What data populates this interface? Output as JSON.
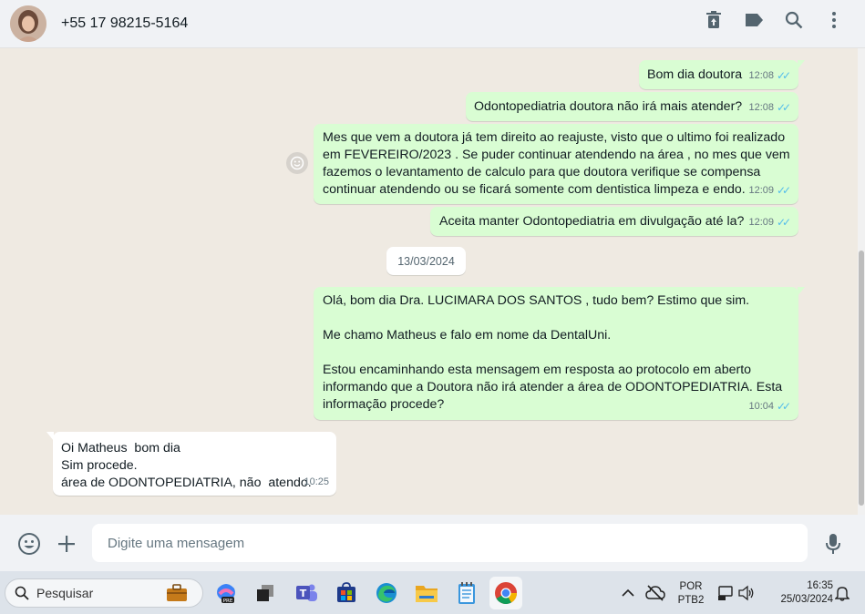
{
  "header": {
    "contact_name": "+55 17 98215-5164",
    "actions": [
      "trash-icon",
      "label-icon",
      "search-icon",
      "more-icon"
    ]
  },
  "messages": [
    {
      "direction": "out",
      "text": "Bom dia doutora",
      "time": "12:08",
      "ticks": "✓✓"
    },
    {
      "direction": "out",
      "text": "Odontopediatria doutora não irá mais atender?",
      "time": "12:08",
      "ticks": "✓✓"
    },
    {
      "direction": "out",
      "text": "Mes que vem a doutora já tem direito ao reajuste, visto que o ultimo foi realizado\nem FEVEREIRO/2023 . Se puder continuar atendendo na área , no mes que vem\nfazemos o levantamento de calculo para que doutora verifique se compensa\ncontinuar atendendo ou se ficará somente com dentistica limpeza e endo.",
      "time": "12:09",
      "ticks": "✓✓"
    },
    {
      "direction": "out",
      "text": "Aceita manter Odontopediatria em divulgação até la?",
      "time": "12:09",
      "ticks": "✓✓"
    },
    {
      "direction": "out",
      "text": "Olá, bom dia Dra. LUCIMARA DOS SANTOS , tudo bem? Estimo que sim.\n\nMe chamo Matheus e falo em nome da DentalUni.\n\nEstou encaminhando esta mensagem em resposta ao protocolo em aberto\ninformando que a Doutora não irá atender a área de ODONTOPEDIATRIA. Esta\ninformação procede?",
      "time": "10:04",
      "ticks": "✓✓"
    },
    {
      "direction": "in",
      "text": "Oi Matheus  bom dia\nSim procede.\nárea de ODONTOPEDIATRIA, não  atendo.",
      "time": "10:25"
    }
  ],
  "date_separator": "13/03/2024",
  "composer": {
    "placeholder": "Digite uma mensagem"
  },
  "taskbar": {
    "search_label": "Pesquisar",
    "language": "POR",
    "keyboard": "PTB2",
    "time": "16:35",
    "date": "25/03/2024"
  },
  "colors": {
    "outgoing_bubble": "#d9fdd3",
    "incoming_bubble": "#ffffff",
    "read_ticks": "#53bdeb",
    "chat_background": "#efeae2"
  }
}
